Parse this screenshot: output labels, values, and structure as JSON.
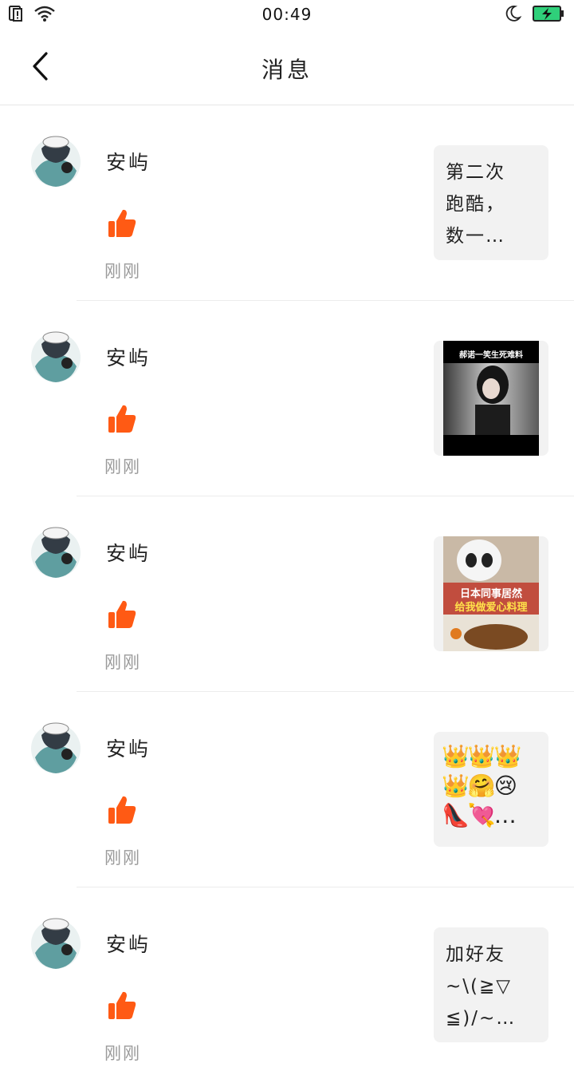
{
  "status_bar": {
    "time": "00:49"
  },
  "header": {
    "title": "消息",
    "back_icon": "chevron-left-icon"
  },
  "messages": [
    {
      "user": "安屿",
      "time": "刚刚",
      "preview_type": "text",
      "preview_text": "第二次\n跑酷，\n数一…"
    },
    {
      "user": "安屿",
      "time": "刚刚",
      "preview_type": "image",
      "image_caption": "郝诺一笑生死难料"
    },
    {
      "user": "安屿",
      "time": "刚刚",
      "preview_type": "image",
      "image_caption_1": "日本同事居然",
      "image_caption_2": "给我做爱心料理"
    },
    {
      "user": "安屿",
      "time": "刚刚",
      "preview_type": "emoji",
      "preview_text": "👑👑👑\n👑🤗😢\n👠💘…"
    },
    {
      "user": "安屿",
      "time": "刚刚",
      "preview_type": "text",
      "preview_text": "加好友\n~\\(≧▽\n≦)/~…"
    }
  ],
  "colors": {
    "like": "#ff5a14",
    "divider": "#ececec",
    "time": "#9a9a9a",
    "preview_bg": "#f2f2f2"
  }
}
